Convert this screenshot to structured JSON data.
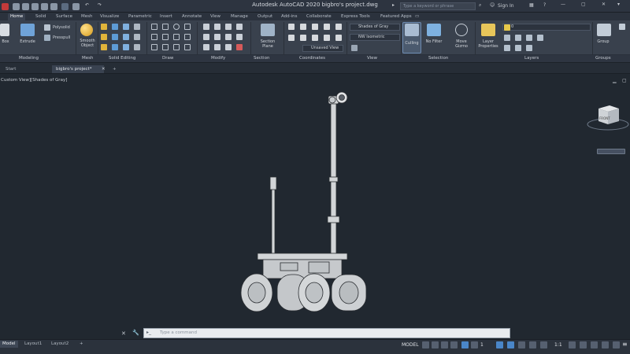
{
  "titlebar": {
    "title": "Autodesk AutoCAD 2020   bigbro's project.dwg",
    "search_placeholder": "Type a keyword or phrase",
    "sign_in": "Sign In"
  },
  "ribbon_tabs": [
    "Home",
    "Solid",
    "Surface",
    "Mesh",
    "Visualize",
    "Parametric",
    "Insert",
    "Annotate",
    "View",
    "Manage",
    "Output",
    "Add-ins",
    "Collaborate",
    "Express Tools",
    "Featured Apps"
  ],
  "ribbon": {
    "modeling": {
      "box_label": "Box",
      "extrude_label": "Extrude",
      "polysolid": "Polysolid",
      "presspull": "Presspull"
    },
    "mesh": {
      "smooth_object": "Smooth Object"
    },
    "section": {
      "section_plane": "Section Plane"
    },
    "view": {
      "visual_style": "Shades of Gray",
      "view_preset": "NW Isometric",
      "ucs": "Unsaved View"
    },
    "selection": {
      "culling": "Culling",
      "no_filter": "No Filter",
      "move_gizmo": "Move Gizmo"
    },
    "layers": {
      "layer_properties": "Layer Properties",
      "layer_value": "0"
    },
    "groups": {
      "group": "Group"
    }
  },
  "panel_labels": [
    "Modeling",
    "Mesh",
    "Solid Editing",
    "Draw",
    "Modify",
    "Section",
    "Coordinates",
    "View",
    "Selection",
    "Layers",
    "Groups"
  ],
  "doc_tabs": {
    "start": "Start",
    "file": "bigbro's project*",
    "add": "+"
  },
  "viewport": {
    "label": "Custom View][Shades of Gray]",
    "viewcube_face": "FRONT"
  },
  "command_line": {
    "placeholder": "Type a command"
  },
  "layout_tabs": [
    "Model",
    "Layout1",
    "Layout2"
  ],
  "statusbar": {
    "model_label": "MODEL",
    "scale": "1:1",
    "add_layout": "+"
  },
  "colors": {
    "background": "#212830",
    "ribbon": "#39414d",
    "accent": "#4a86c8",
    "model_gray": "#cfd2d4"
  }
}
